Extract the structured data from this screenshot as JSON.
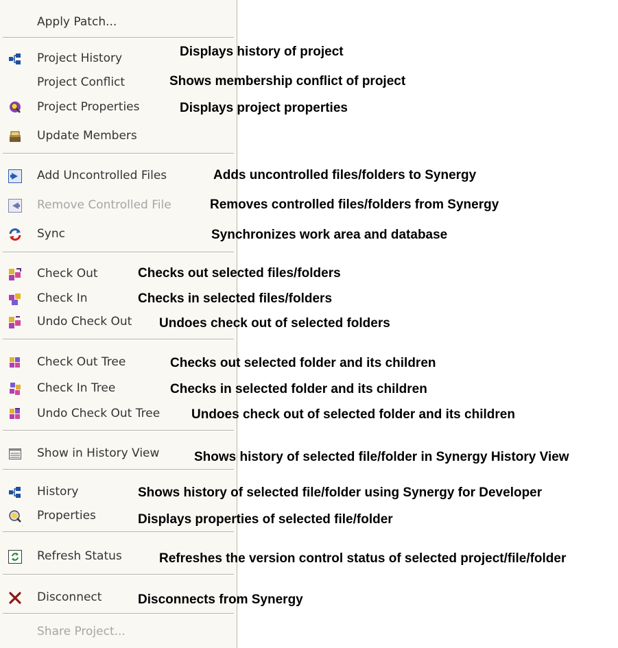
{
  "menu": {
    "items": [
      {
        "label": "Apply Patch...",
        "icon": "none",
        "enabled": true
      },
      {
        "label": "Project History",
        "icon": "history-icon",
        "enabled": true
      },
      {
        "label": "Project Conflict",
        "icon": "none",
        "enabled": true
      },
      {
        "label": "Project Properties",
        "icon": "properties-icon",
        "enabled": true
      },
      {
        "label": "Update Members",
        "icon": "update-members-icon",
        "enabled": true
      },
      {
        "label": "Add Uncontrolled Files",
        "icon": "add-arrow-icon",
        "enabled": true
      },
      {
        "label": "Remove Controlled File",
        "icon": "remove-arrow-icon",
        "enabled": false
      },
      {
        "label": "Sync",
        "icon": "sync-icon",
        "enabled": true
      },
      {
        "label": "Check Out",
        "icon": "check-out-icon",
        "enabled": true
      },
      {
        "label": "Check In",
        "icon": "check-in-icon",
        "enabled": true
      },
      {
        "label": "Undo Check Out",
        "icon": "undo-check-out-icon",
        "enabled": true
      },
      {
        "label": "Check Out Tree",
        "icon": "check-out-tree-icon",
        "enabled": true
      },
      {
        "label": "Check In Tree",
        "icon": "check-in-tree-icon",
        "enabled": true
      },
      {
        "label": "Undo Check Out Tree",
        "icon": "undo-check-out-tree-icon",
        "enabled": true
      },
      {
        "label": "Show in History View",
        "icon": "history-view-icon",
        "enabled": true
      },
      {
        "label": "History",
        "icon": "history-icon",
        "enabled": true
      },
      {
        "label": "Properties",
        "icon": "properties-icon",
        "enabled": true
      },
      {
        "label": "Refresh Status",
        "icon": "refresh-icon",
        "enabled": true
      },
      {
        "label": "Disconnect",
        "icon": "disconnect-icon",
        "enabled": true
      },
      {
        "label": "Share Project...",
        "icon": "none",
        "enabled": false
      }
    ]
  },
  "descriptions": [
    "Displays history of project",
    "Shows membership conflict of project",
    "Displays project properties",
    "Adds uncontrolled files/folders to Synergy",
    "Removes controlled files/folders from Synergy",
    "Synchronizes work area and database",
    "Checks out selected files/folders",
    "Checks in selected files/folders",
    "Undoes check out of selected folders",
    "Checks out selected folder and its children",
    "Checks in selected folder and its children",
    "Undoes check out of selected folder and its children",
    "Shows history of selected file/folder in Synergy History View",
    "Shows history of selected file/folder using Synergy for Developer",
    "Displays properties of selected file/folder",
    "Refreshes the version control status of selected project/file/folder",
    "Disconnects from Synergy"
  ],
  "colors": {
    "menu_background": "#f9f8f3",
    "disabled_text": "#a6a6a6",
    "accent_blue": "#2a5db0",
    "disconnect_red": "#8b1a1a"
  }
}
